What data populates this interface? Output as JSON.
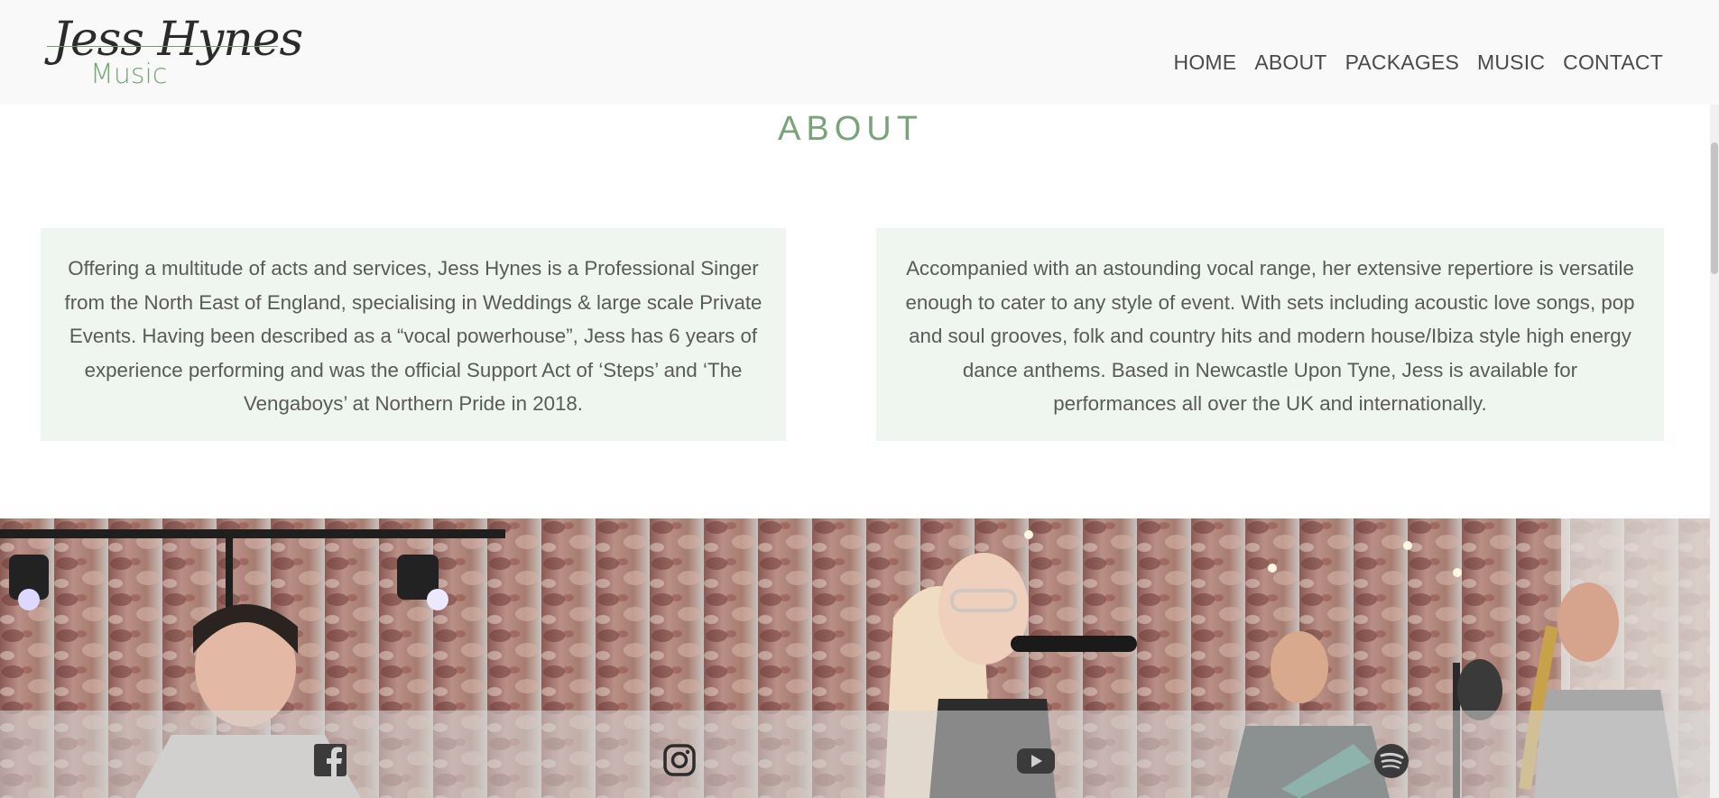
{
  "logo": {
    "script_text": "Jess Hynes",
    "sub_text": "Music"
  },
  "nav": {
    "items": [
      {
        "label": "HOME"
      },
      {
        "label": "ABOUT"
      },
      {
        "label": "PACKAGES"
      },
      {
        "label": "MUSIC"
      },
      {
        "label": "CONTACT"
      }
    ]
  },
  "about": {
    "title": "ABOUT",
    "left_text": "Offering a multitude of acts and services, Jess Hynes is a Professional Singer from the North East of England, specialising in Weddings & large scale Private Events. Having been described as a “vocal powerhouse”, Jess has 6 years of experience performing and was the official Support Act of ‘Steps’ and ‘The Vengaboys’ at Northern Pride in 2018.",
    "right_text": "Accompanied with an astounding vocal range, her extensive repertiore is versatile enough to cater to any style of event. With sets including acoustic love songs, pop and soul grooves, folk and country hits and modern house/Ibiza style high energy dance anthems. Based in Newcastle Upon Tyne, Jess is available for performances all over the UK and internationally."
  },
  "social": {
    "icons": [
      "facebook-icon",
      "instagram-icon",
      "youtube-icon",
      "spotify-icon"
    ]
  },
  "colors": {
    "accent_green": "#7aa37a",
    "card_bg": "#eff5ef",
    "header_bg": "#f9f9f9"
  }
}
